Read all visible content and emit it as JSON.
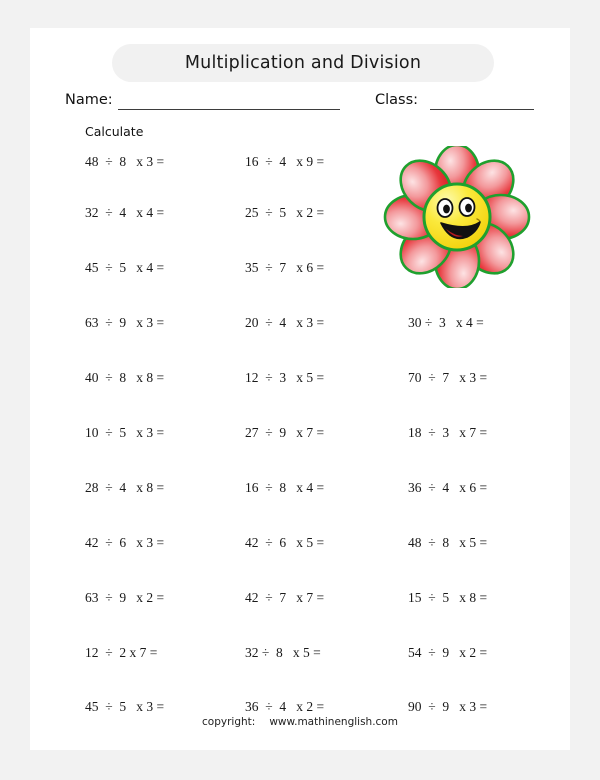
{
  "title": "Multiplication and Division",
  "fields": {
    "name_label": "Name:",
    "class_label": "Class:",
    "name_value": "",
    "class_value": ""
  },
  "instruction": "Calculate",
  "footer": {
    "copyright_label": "copyright:",
    "site": "www.mathinenglish.com"
  },
  "illustration": {
    "name": "smiley-flower",
    "petal_count": 8,
    "petal_color": "#e8242a",
    "petal_highlight": "#f9b9bb",
    "petal_outline": "#1fa02e",
    "center_color": "#f5e11e",
    "center_highlight": "#fdf582",
    "center_outline": "#1fa02e",
    "mouth_color": "#111111",
    "tongue_color": "#b81a20"
  },
  "problems": {
    "columns": 3,
    "rows": [
      {
        "c0": "48  ÷  8   x 3 =",
        "c1": "16  ÷  4   x 9 =",
        "c2": ""
      },
      {
        "c0": "32  ÷  4   x 4 =",
        "c1": "25  ÷  5   x 2 =",
        "c2": ""
      },
      {
        "c0": "45  ÷  5   x 4 =",
        "c1": "35  ÷  7   x 6 =",
        "c2": ""
      },
      {
        "c0": "63  ÷  9   x 3 =",
        "c1": "20  ÷  4   x 3 =",
        "c2": "30 ÷  3   x 4 ="
      },
      {
        "c0": "40  ÷  8   x 8 =",
        "c1": "12  ÷  3   x 5 =",
        "c2": "70  ÷  7   x 3 ="
      },
      {
        "c0": "10  ÷  5   x 3 =",
        "c1": "27  ÷  9   x 7 =",
        "c2": "18  ÷  3   x 7 ="
      },
      {
        "c0": "28  ÷  4   x 8 =",
        "c1": "16  ÷  8   x 4 =",
        "c2": "36  ÷  4   x 6 ="
      },
      {
        "c0": "42  ÷  6   x 3 =",
        "c1": "42  ÷  6   x 5 =",
        "c2": "48  ÷  8   x 5 ="
      },
      {
        "c0": "63  ÷  9   x 2 =",
        "c1": "42  ÷  7   x 7 =",
        "c2": "15  ÷  5   x 8 ="
      },
      {
        "c0": "12  ÷  2 x 7 =",
        "c1": "32 ÷  8   x 5 =",
        "c2": "54  ÷  9   x 2 ="
      },
      {
        "c0": "45  ÷  5   x 3 =",
        "c1": "36  ÷  4   x 2 =",
        "c2": "90  ÷  9   x 3 ="
      }
    ]
  }
}
